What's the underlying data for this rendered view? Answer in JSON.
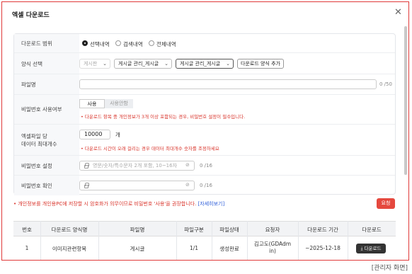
{
  "dialog": {
    "title": "엑셀 다운로드"
  },
  "form": {
    "scope": {
      "label": "다운로드 범위",
      "options": [
        "선택내역",
        "검색내역",
        "전체내역"
      ],
      "selected": 0
    },
    "format": {
      "label": "양식 선택",
      "select1": "게시판",
      "select2": "게시글 관리_게시글",
      "select3": "게시글 관리_게시글",
      "add_button": "다운로드 양식 추가"
    },
    "filename": {
      "label": "파일명",
      "value": "",
      "counter": "0 /50"
    },
    "password_use": {
      "label": "비밀번호 사용여부",
      "on": "사용",
      "off": "사용안함",
      "warning": "다운로드 항목 중 개인정보가 3개 이상 포함되는 경우, 비밀번호 설정이 필수입니다."
    },
    "max_rows": {
      "label1": "엑셀파일 당",
      "label2": "데이터 최대개수",
      "value": "10000",
      "unit": "개",
      "warning": "다운로드 시간이 오래 걸리는 경우 데이터 최대개수 숫자를 조정하세요"
    },
    "pw_set": {
      "label": "비밀번호 설정",
      "placeholder": "영문/숫자/특수문자 2개 포함, 10~16자",
      "counter": "0 /16"
    },
    "pw_confirm": {
      "label": "비밀번호 확인",
      "placeholder": "",
      "counter": "0 /16"
    }
  },
  "notice": {
    "text": "개인정보를 개인용PC에 저장할 시 암호화가 의무이므로 비밀번호 '사용'을 권장합니다.",
    "link": "[자세히보기]"
  },
  "request_button": "요청",
  "table": {
    "headers": [
      "번호",
      "다운로드 양식명",
      "파일명",
      "파일구분",
      "파일상태",
      "요청자",
      "다운로드 기간",
      "다운로드"
    ],
    "rows": [
      {
        "no": "1",
        "format": "이미지관련항목",
        "filename": "게시글",
        "part": "1/1",
        "status": "생성완료",
        "requester1": "김고도(GDAdm",
        "requester2": "in)",
        "period": "~2025-12-18",
        "download": "다운로드"
      }
    ]
  },
  "caption": "[관리자 화면]"
}
